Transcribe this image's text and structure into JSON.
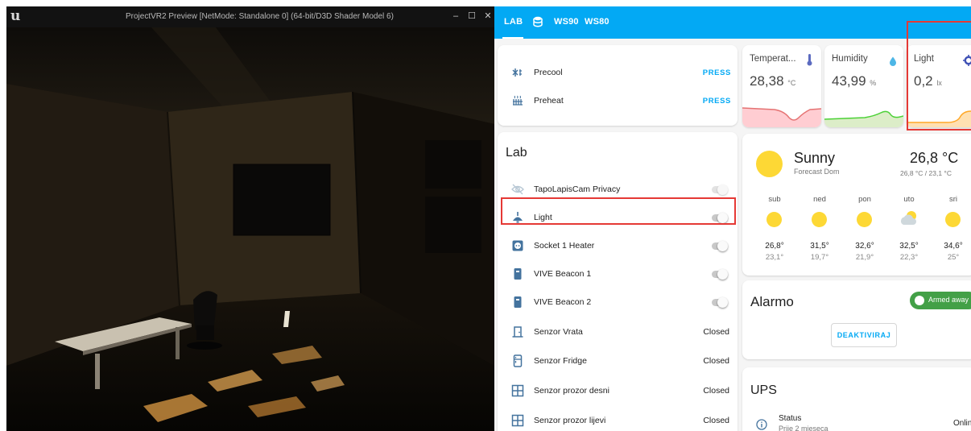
{
  "unreal": {
    "title": "ProjectVR2 Preview [NetMode: Standalone 0]  (64-bit/D3D Shader Model 6)",
    "controls": {
      "minimize": "–",
      "maximize": "☐",
      "close": "✕"
    }
  },
  "header": {
    "tabs": [
      {
        "label": "LAB"
      },
      {
        "label": "WS90"
      },
      {
        "label": "WS80"
      }
    ]
  },
  "scripts_card": {
    "rows": [
      {
        "label": "Precool",
        "action": "PRESS",
        "icon": "fan-snowflake-icon"
      },
      {
        "label": "Preheat",
        "action": "PRESS",
        "icon": "radiator-icon"
      }
    ]
  },
  "lab_card": {
    "title": "Lab",
    "rows": [
      {
        "label": "TapoLapisCam Privacy",
        "icon": "eye-off-icon",
        "type": "toggle",
        "on": false
      },
      {
        "label": "Light",
        "icon": "ceiling-light-icon",
        "type": "toggle",
        "on": false
      },
      {
        "label": "Socket 1 Heater",
        "icon": "socket-icon",
        "type": "toggle",
        "on": false
      },
      {
        "label": "VIVE Beacon 1",
        "icon": "beacon-icon",
        "type": "toggle",
        "on": false
      },
      {
        "label": "VIVE Beacon 2",
        "icon": "beacon-icon",
        "type": "toggle",
        "on": false
      },
      {
        "label": "Senzor Vrata",
        "icon": "door-icon",
        "type": "state",
        "state": "Closed"
      },
      {
        "label": "Senzor Fridge",
        "icon": "fridge-icon",
        "type": "state",
        "state": "Closed"
      },
      {
        "label": "Senzor prozor desni",
        "icon": "window-icon",
        "type": "state",
        "state": "Closed"
      },
      {
        "label": "Senzor prozor lijevi",
        "icon": "window-icon",
        "type": "state",
        "state": "Closed"
      }
    ]
  },
  "sensors": [
    {
      "name": "Temperat...",
      "value": "28,38",
      "unit": "°C",
      "icon": "thermometer-icon",
      "icon_color": "#5c6bc0",
      "graph_color": "#e57373"
    },
    {
      "name": "Humidity",
      "value": "43,99",
      "unit": "%",
      "icon": "water-drop-icon",
      "icon_color": "#4db6e6",
      "graph_color": "#4cd137"
    },
    {
      "name": "Light",
      "value": "0,2",
      "unit": "lx",
      "icon": "brightness-icon",
      "icon_color": "#3f51b5",
      "graph_color": "#ffa726"
    }
  ],
  "weather": {
    "condition": "Sunny",
    "source": "Forecast Dom",
    "temperature": "26,8 °C",
    "range": "26,8 °C / 23,1 °C",
    "forecast": [
      {
        "day": "sub",
        "high": "26,8°",
        "low": "23,1°",
        "icon": "sun-icon"
      },
      {
        "day": "ned",
        "high": "31,5°",
        "low": "19,7°",
        "icon": "sun-icon"
      },
      {
        "day": "pon",
        "high": "32,6°",
        "low": "21,9°",
        "icon": "sun-icon"
      },
      {
        "day": "uto",
        "high": "32,5°",
        "low": "22,3°",
        "icon": "partly-cloudy-icon"
      },
      {
        "day": "sri",
        "high": "34,6°",
        "low": "25°",
        "icon": "sun-icon"
      }
    ]
  },
  "alarmo": {
    "title": "Alarmo",
    "badge": "Armed away",
    "button": "DEAKTIVIRAJ"
  },
  "ups": {
    "title": "UPS",
    "status_label": "Status",
    "status_time": "Prije 2 mjeseca",
    "status_value": "Online"
  },
  "colors": {
    "header": "#03a9f4",
    "highlight": "#e53935",
    "sun": "#fdd835",
    "alarm_badge": "#43a047"
  }
}
